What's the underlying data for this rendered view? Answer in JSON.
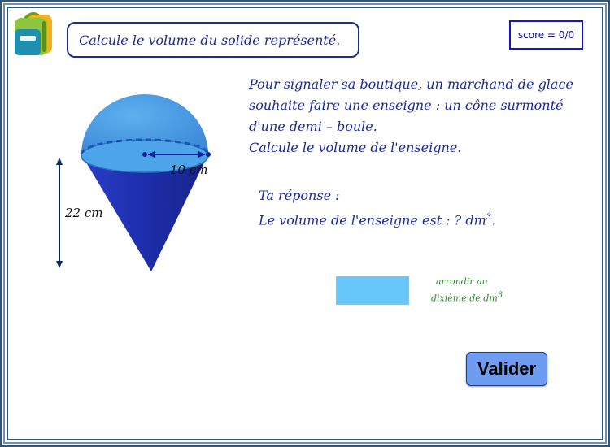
{
  "header": {
    "instruction": "Calcule le volume du solide représenté.",
    "score_label": "score = 0/0"
  },
  "figure": {
    "radius_label": "10 cm",
    "height_label": "22 cm"
  },
  "problem": {
    "lines": [
      "Pour signaler sa boutique, un marchand de glace",
      "souhaite faire une enseigne : un cône surmonté",
      "d'une demi – boule.",
      "Calcule le volume de l'enseigne."
    ]
  },
  "answer": {
    "prompt": "Ta réponse :",
    "sentence": "Le volume de l'enseigne est : ? dm",
    "sentence_exponent": "3",
    "sentence_end": ".",
    "input_value": ""
  },
  "hint": {
    "line1": "arrondir au",
    "line2": "dixième de dm",
    "line2_exponent": "3"
  },
  "validate_label": "Valider",
  "colors": {
    "frame": "#2e5480",
    "text_blue": "#1a2a9a",
    "hint_green": "#2b8a2b",
    "input_bg": "#67c7fb",
    "button_bg": "#6e9cf0",
    "cone": "#2233b8",
    "hemisphere": "#4a9ae0"
  },
  "icons": {
    "app_logo": "backpack-icon"
  }
}
